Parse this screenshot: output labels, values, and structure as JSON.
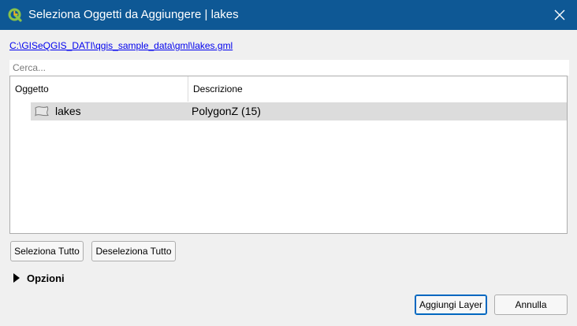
{
  "window": {
    "title": "Seleziona Oggetti da Aggiungere | lakes",
    "app_icon": "qgis-logo-icon",
    "close_icon": "close-icon",
    "titlebar_color": "#0e5895"
  },
  "source_path": "C:\\GISeQGIS_DATI\\qgis_sample_data\\gml\\lakes.gml",
  "search": {
    "placeholder": "Cerca...",
    "value": ""
  },
  "tree": {
    "columns": [
      "Oggetto",
      "Descrizione"
    ],
    "rows": [
      {
        "icon": "polygon-layer-icon",
        "name": "lakes",
        "description": "PolygonZ (15)",
        "selected": true
      }
    ]
  },
  "buttons": {
    "select_all": "Seleziona Tutto",
    "deselect_all": "Deseleziona Tutto",
    "add_layer": "Aggiungi Layer",
    "cancel": "Annulla"
  },
  "options": {
    "label": "Opzioni",
    "expanded": false,
    "icon": "expand-arrow-icon"
  }
}
